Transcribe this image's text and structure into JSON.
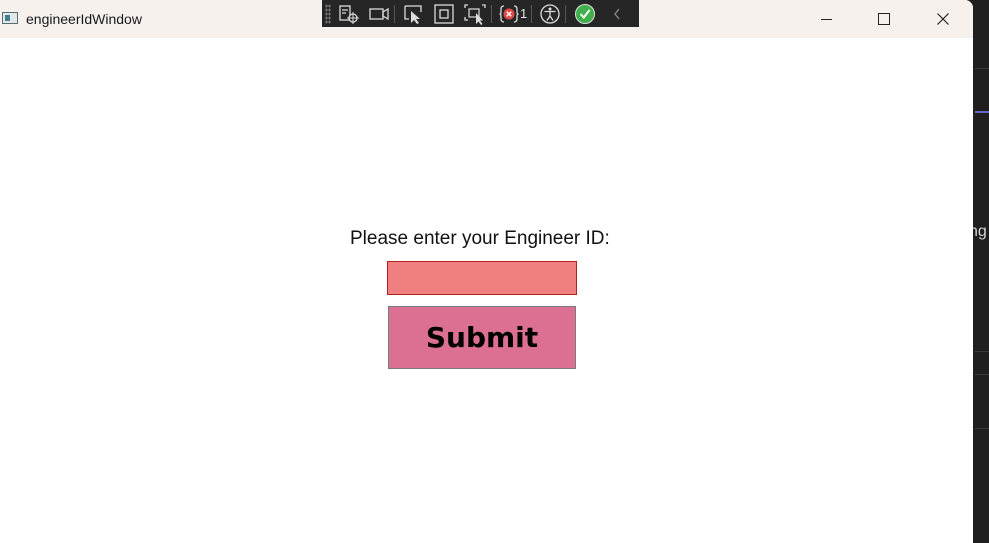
{
  "window": {
    "title": "engineerIdWindow"
  },
  "debug_toolbar": {
    "buttons": [
      {
        "icon": "live-visual-tree-icon"
      },
      {
        "icon": "camera-icon"
      },
      {
        "icon": "select-element-icon"
      },
      {
        "icon": "display-layout-adorners-icon"
      },
      {
        "icon": "track-focus-icon"
      },
      {
        "icon": "binding-failures-icon"
      },
      {
        "icon": "accessibility-icon"
      },
      {
        "icon": "hot-reload-check-icon"
      },
      {
        "icon": "collapse-chevron-icon"
      }
    ],
    "binding_failures_count": "1"
  },
  "form": {
    "label": "Please enter your Engineer ID:",
    "input_value": "",
    "submit_label": "Submit"
  },
  "background_app": {
    "partial_text": "ng"
  },
  "colors": {
    "input_background": "#f08080",
    "input_border": "#b22222",
    "submit_background": "#db7093",
    "titlebar_background": "#f6f1ec",
    "toolbar_background": "#262626",
    "hot_reload_ok": "#3fb04c"
  }
}
